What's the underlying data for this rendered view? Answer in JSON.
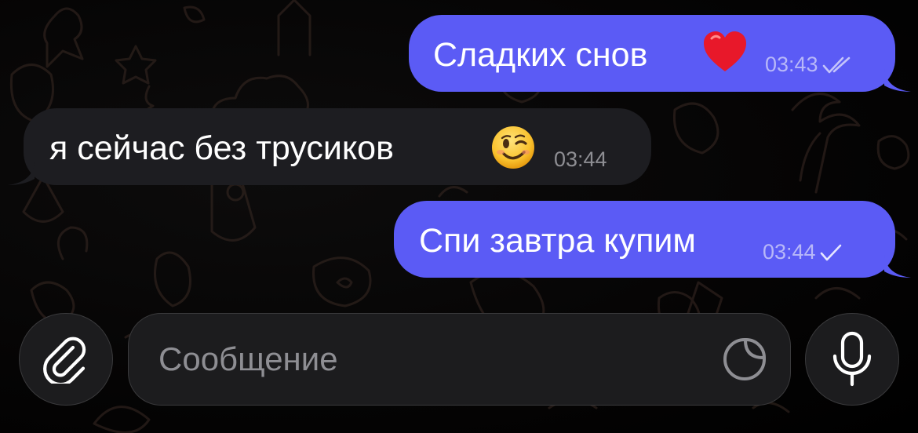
{
  "chat": {
    "messages": [
      {
        "direction": "outgoing",
        "text": "Сладких снов",
        "emoji": "❤️",
        "time": "03:43",
        "status": "read"
      },
      {
        "direction": "incoming",
        "text": "я сейчас без трусиков",
        "emoji": "😉",
        "time": "03:44"
      },
      {
        "direction": "outgoing",
        "text": "Спи завтра купим",
        "time": "03:44",
        "status": "sent"
      }
    ]
  },
  "composer": {
    "placeholder": "Сообщение",
    "value": "",
    "attach_icon": "paperclip-icon",
    "sticker_icon": "sticker-icon",
    "mic_icon": "microphone-icon"
  },
  "colors": {
    "outgoing_bubble": "#5b5bf5",
    "incoming_bubble": "#1d1d21",
    "background": "#000000",
    "control_background": "#1c1c1e"
  }
}
